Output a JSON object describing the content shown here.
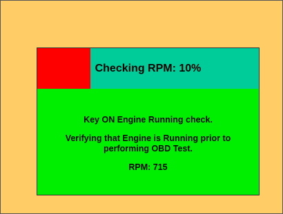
{
  "colors": {
    "background": "#ffcc66",
    "panel": "#00ee00",
    "progress_track": "#00cc99",
    "progress_fill": "#ff0000"
  },
  "progress": {
    "label": "Checking RPM: 10%",
    "fraction": 0.24
  },
  "message": {
    "title": "Key ON Engine Running check.",
    "line1": "Verifying that Engine is Running prior to",
    "line2": "performing OBD Test.",
    "rpm": "RPM: 715"
  }
}
